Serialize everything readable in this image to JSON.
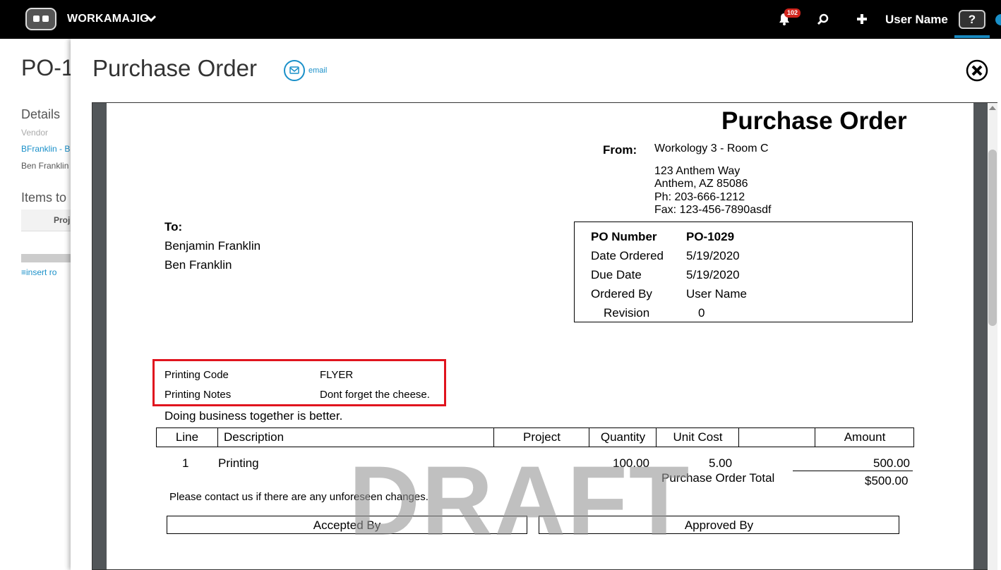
{
  "topbar": {
    "brand": "WORKAMAJIG",
    "notification_count": "102",
    "user_name": "User Name",
    "help_label": "?"
  },
  "background": {
    "title": "PO-1",
    "details_heading": "Details",
    "vendor_label": "Vendor",
    "vendor_link": "BFranklin - B",
    "vendor_contact": "Ben Franklin",
    "items_heading": "Items to",
    "table_col": "Proj",
    "insert_row": "insert ro"
  },
  "modal": {
    "title": "Purchase Order",
    "email_label": "email"
  },
  "document": {
    "title": "Purchase Order",
    "from_label": "From:",
    "from_name": "Workology 3 - Room C",
    "address_lines": [
      "123 Anthem Way",
      "Anthem, AZ 85086",
      "Ph: 203-666-1212",
      "Fax: 123-456-7890asdf"
    ],
    "to_label": "To:",
    "to_lines": [
      "Benjamin  Franklin",
      "Ben Franklin"
    ],
    "po_info": [
      {
        "label": "PO Number",
        "value": "PO-1029"
      },
      {
        "label": "Date Ordered",
        "value": "5/19/2020"
      },
      {
        "label": "Due Date",
        "value": "5/19/2020"
      },
      {
        "label": "Ordered By",
        "value": "User Name"
      },
      {
        "label": "Revision",
        "value": "0"
      }
    ],
    "custom_fields": [
      {
        "label": "Printing Code",
        "value": "FLYER"
      },
      {
        "label": "Printing Notes",
        "value": "Dont forget the cheese."
      }
    ],
    "tagline": "Doing business together is better.",
    "columns": [
      "Line",
      "Description",
      "Project",
      "Quantity",
      "Unit Cost",
      "",
      "Amount"
    ],
    "line_items": [
      {
        "line": "1",
        "description": "Printing",
        "project": "",
        "quantity": "100.00",
        "unit_cost": "5.00",
        "amount": "500.00"
      }
    ],
    "total_label": "Purchase Order Total",
    "total_value": "$500.00",
    "contact_note": "Please contact us if there are any unforeseen changes.",
    "accepted_by": "Accepted By",
    "approved_by": "Approved By",
    "watermark": "DRAFT"
  },
  "colors": {
    "accent": "#1a90c9",
    "highlight_box": "#e0141e",
    "badge": "#d0241c"
  }
}
